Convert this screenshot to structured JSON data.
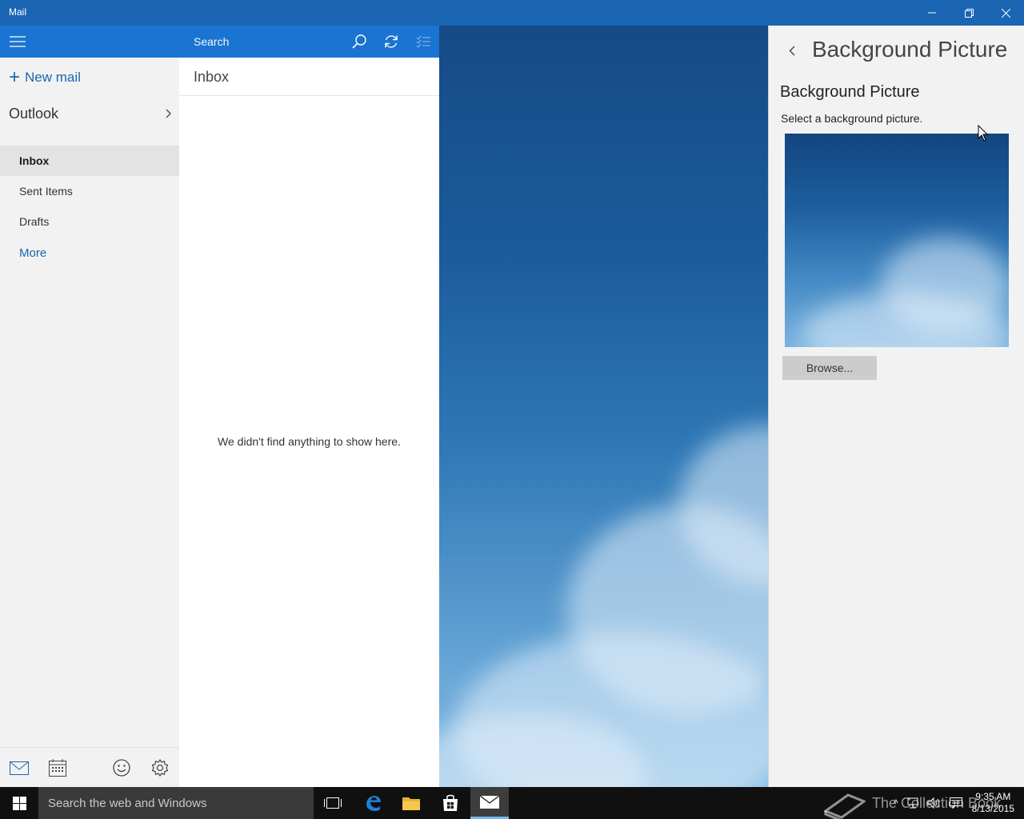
{
  "window": {
    "title": "Mail"
  },
  "nav": {
    "new_mail_label": "New mail",
    "account_name": "Outlook",
    "folders": [
      {
        "label": "Inbox",
        "active": true
      },
      {
        "label": "Sent Items",
        "active": false
      },
      {
        "label": "Drafts",
        "active": false
      }
    ],
    "more_label": "More"
  },
  "message_list": {
    "search_placeholder": "Search",
    "folder_title": "Inbox",
    "empty_message": "We didn't find anything to show here."
  },
  "settings_panel": {
    "title": "Background Picture",
    "section_title": "Background Picture",
    "description": "Select a background picture.",
    "browse_label": "Browse..."
  },
  "taskbar": {
    "search_placeholder": "Search the web and Windows",
    "time": "9:35 AM",
    "date": "8/13/2015",
    "watermark": "The Collection Book"
  },
  "colors": {
    "accent": "#1a74d1",
    "titlebar": "#1a66b2",
    "link": "#1a66b2",
    "taskbar": "#101010"
  }
}
